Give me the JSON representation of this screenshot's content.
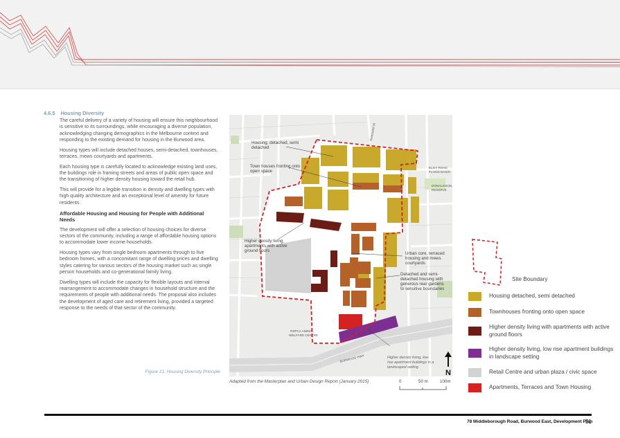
{
  "section": {
    "number": "4.6.5",
    "title": "Housing Diversity",
    "paragraphs": [
      "The careful delivery of a variety of housing will ensure this neighbourhood is sensitive to its surroundings, while encouraging a diverse population, acknowledging changing demographics in the Melbourne context and responding to the existing demand for housing in the Burwood area.",
      "Housing types will include detached houses, semi-detached, townhouses, terraces, mews courtyards and apartments.",
      "Each housing type is carefully located to acknowledge existing land uses, the buildings role in framing streets and areas of public open space and the transitioning of higher density housing toward the retail hub.",
      "This will provide for a legible transition in density and dwelling types with high quality architecture and an exceptional level of amenity for future residents."
    ],
    "subheading": "Affordable Housing and Housing for People with Additional Needs",
    "paragraphs2": [
      "The development will offer a selection of housing choices for diverse sectors of the community, including a range of affordable housing options to accommodate lower income households.",
      "Housing types vary from single bedroom apartments through to five bedroom homes, with a concomitant range of dwelling prices and dwelling styles catering for various sectors of the housing market such as single person households and co-generational family living.",
      "Dwelling types will include the capacity for flexible layouts and internal rearrangement to accommodate changes in household structure and the requirements of people with additional needs. The proposal also includes the development of aged care and retirement living, provided a targeted response to the needs of that sector of the community."
    ]
  },
  "figure": {
    "caption_num": "Figure 21:",
    "caption_text": "Housing Diversity Principle",
    "source": "Adapted from the Masterplan and Urban Design Report (January 2015)"
  },
  "map_labels": {
    "l1a": "Housing, detached, semi",
    "l1b": "detached",
    "l2a": "Town houses fronting onto",
    "l2b": "open space",
    "l3a": "Higher density living,",
    "l3b": "apartments with active",
    "l3c": "ground floors",
    "l4a": "Urban core, terraced",
    "l4b": "housing and mews",
    "l4c": "courtyards",
    "l5a": "Detached and semi-",
    "l5b": "detached housing with",
    "l5c": "generous rear gardens",
    "l5d": "to sensitive boundaries",
    "l6a": "Higher density living, low",
    "l6b": "rise apartment buildings in a",
    "l6c": "landscaped setting",
    "rspca_a": "RSPCA ANIMAL",
    "rspca_b": "WELFARE CENTRE",
    "elgar_a": "ELGY ROAD",
    "elgar_b": "FLOOD BASIN",
    "donald_a": "DONALDSON",
    "donald_b": "RESERVE",
    "richmond": "Richmond St",
    "burwood": "BURWOOD HWY"
  },
  "legend": {
    "site_boundary": "Site Boundary",
    "items": [
      {
        "label": "Housing detached, semi detached",
        "color": "#c9a92c"
      },
      {
        "label": "Townhouses fronting onto open space",
        "color": "#b5612a"
      },
      {
        "label": "Higher density living with apartments with active ground floors",
        "color": "#6b1d15"
      },
      {
        "label": "Higher density living, low rise apartment buildings in landscape setting",
        "color": "#7d2e91"
      },
      {
        "label": "Retail Centre and urban plaza / civic space",
        "color": "#d2d2d2"
      },
      {
        "label": "Apartments, Terraces and Town Housing",
        "color": "#d42222"
      }
    ]
  },
  "scale": {
    "t0": "0",
    "t1": "50 m",
    "t2": "100m"
  },
  "north": "N",
  "footer": {
    "text": "78 Middleborough Road, Burwood East, Development Plan",
    "page": "31"
  },
  "colors": {
    "accent_red": "#d42222",
    "heading_blue": "#7a9fb0",
    "banner_bg": "#f2f2f2"
  }
}
